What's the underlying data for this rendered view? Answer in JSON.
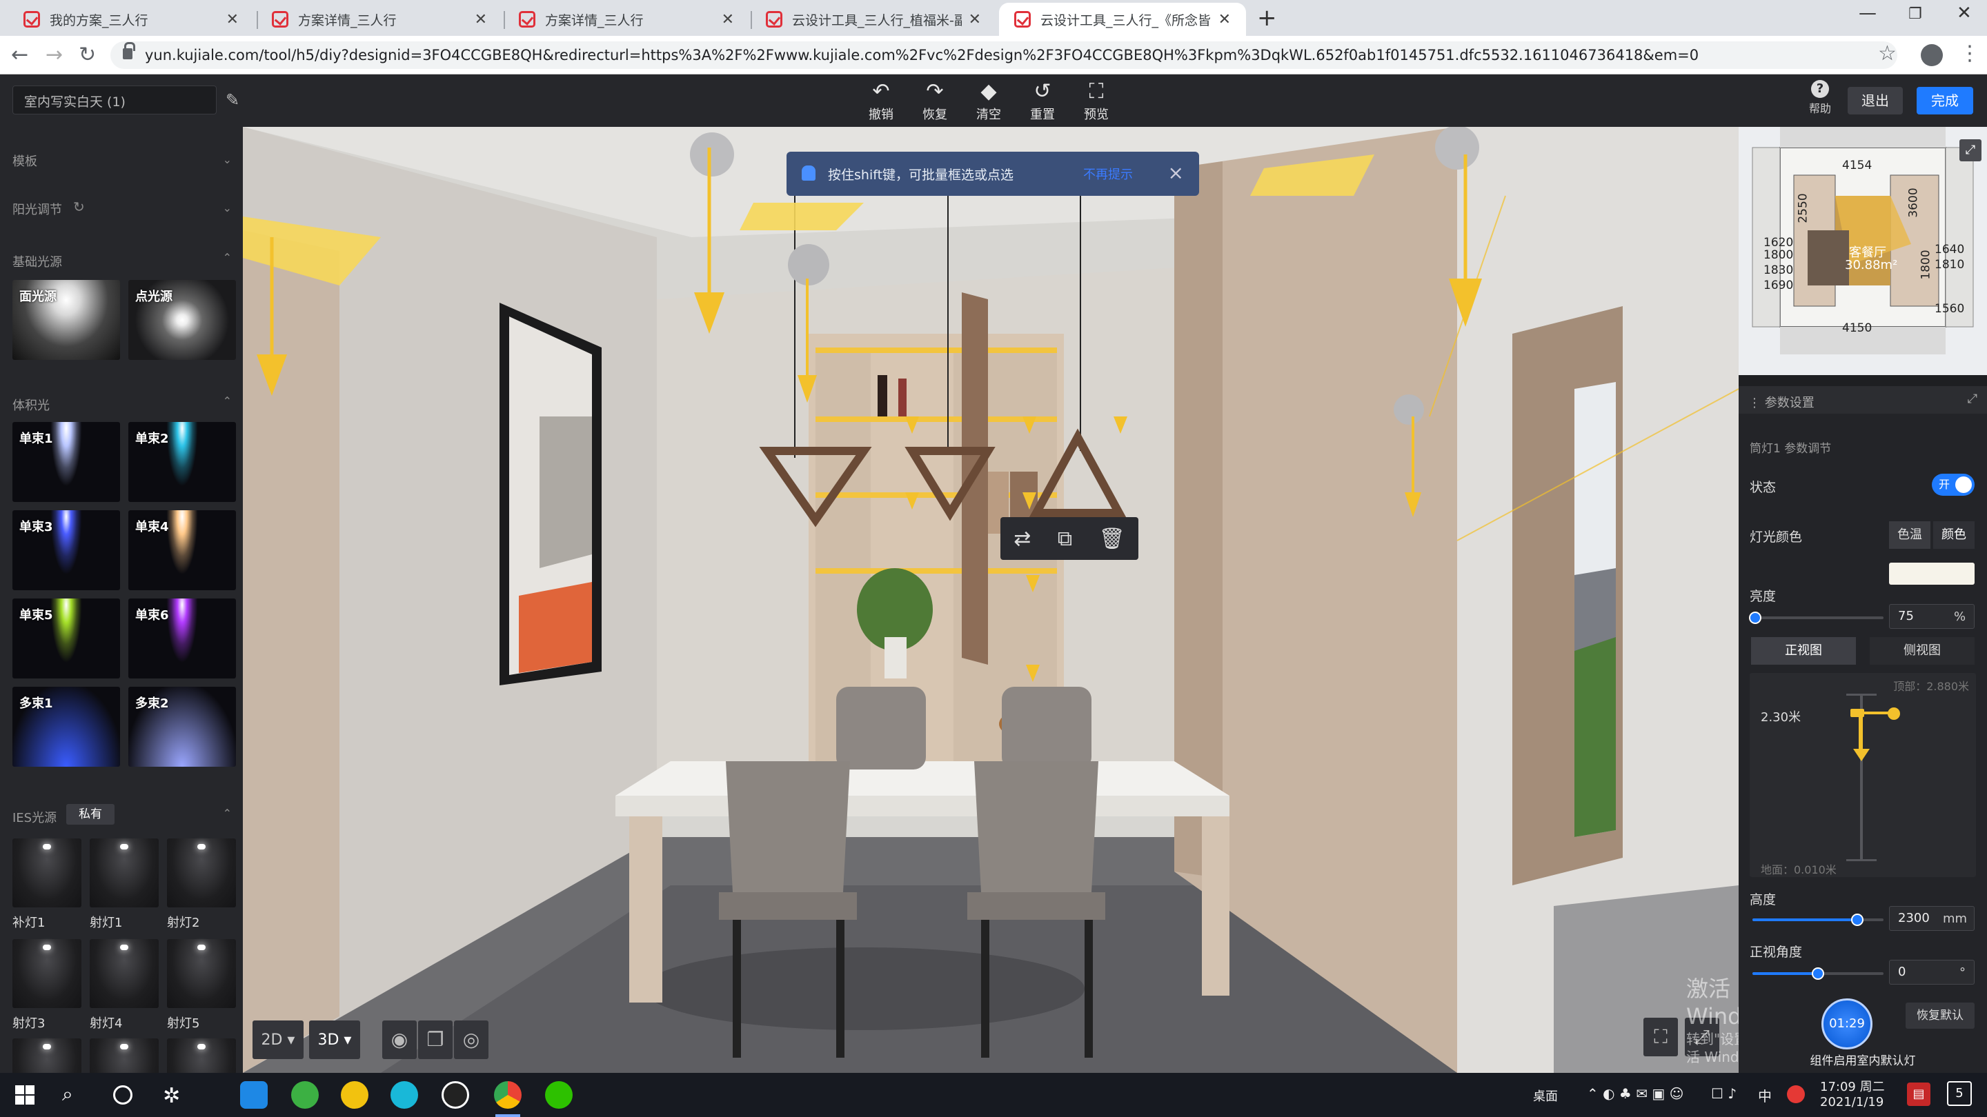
{
  "browser": {
    "tabs": [
      {
        "label": "我的方案_三人行",
        "active": false
      },
      {
        "label": "方案详情_三人行",
        "active": false
      },
      {
        "label": "方案详情_三人行",
        "active": false
      },
      {
        "label": "云设计工具_三人行_植福米-副本",
        "active": false
      },
      {
        "label": "云设计工具_三人行_《所念皆星",
        "active": true
      }
    ],
    "new_tab": "+",
    "url": "yun.kujiale.com/tool/h5/diy?designid=3FO4CCGBE8QH&redirecturl=https%3A%2F%2Fwww.kujiale.com%2Fvc%2Fdesign%2F3FO4CCGBE8QH%3Fkpm%3DqkWL.652f0ab1f0145751.dfc5532.1611046736418&em=0"
  },
  "app": {
    "scheme_name": "室内写实白天 (1)",
    "toolbar": [
      {
        "label": "撤销",
        "icon": "undo-icon",
        "glyph": "↶"
      },
      {
        "label": "恢复",
        "icon": "redo-icon",
        "glyph": "↷"
      },
      {
        "label": "清空",
        "icon": "eraser-icon",
        "glyph": "◆"
      },
      {
        "label": "重置",
        "icon": "reset-icon",
        "glyph": "↺"
      },
      {
        "label": "预览",
        "icon": "preview-icon",
        "glyph": "⛶"
      }
    ],
    "help": "帮助",
    "help_glyph": "?",
    "exit": "退出",
    "done": "完成"
  },
  "left": {
    "template": "模板",
    "sun": "阳光调节",
    "basic_lights": "基础光源",
    "basic": [
      {
        "label": "面光源"
      },
      {
        "label": "点光源"
      }
    ],
    "volume_lights": "体积光",
    "volume": [
      {
        "label": "单束1",
        "color": "#b9c6ff"
      },
      {
        "label": "单束2",
        "color": "#2ec4e8"
      },
      {
        "label": "单束3",
        "color": "#4a5cff"
      },
      {
        "label": "单束4",
        "color": "#ffc98a"
      },
      {
        "label": "单束5",
        "color": "#a6e02a"
      },
      {
        "label": "单束6",
        "color": "#b23cff"
      },
      {
        "label": "多束1",
        "color": "#3a5cff"
      },
      {
        "label": "多束2",
        "color": "#9aa6ff"
      }
    ],
    "ies": "IES光源",
    "ies_private": "私有",
    "ies_items": [
      "补灯1",
      "射灯1",
      "射灯2",
      "射灯3",
      "射灯4",
      "射灯5"
    ]
  },
  "viewport": {
    "tooltip": "按住shift键，可批量框选或点选",
    "tooltip_link": "不再提示",
    "view_2d": "2D",
    "view_3d": "3D",
    "watermark_title": "激活 Windows",
    "watermark_sub": "转到\"设置\"以激活 Windows。"
  },
  "minimap": {
    "dims": [
      "4154",
      "2550",
      "1800",
      "1620",
      "1830",
      "1690",
      "3600",
      "1640",
      "1810",
      "1560",
      "4150",
      "1800"
    ],
    "room_label": "客餐厅",
    "room_area": "30.88m²"
  },
  "params": {
    "header": "参数设置",
    "subtitle": "筒灯1 参数调节",
    "state_label": "状态",
    "state_value": "开",
    "light_color_label": "灯光颜色",
    "color_temp_tab": "色温",
    "color_tab": "颜色",
    "swatch_color": "#f6f3ea",
    "brightness_label": "亮度",
    "brightness_value": "75",
    "brightness_unit": "%",
    "brightness_fraction": 0.02,
    "front_view": "正视图",
    "side_view": "侧视图",
    "ceiling_label": "顶部：2.880米",
    "floor_label": "地面：0.010米",
    "fixture_height_label": "2.30米",
    "height_label": "高度",
    "height_value": "2300",
    "height_unit": "mm",
    "height_fraction": 0.8,
    "angle_label": "正视角度",
    "angle_value": "0",
    "angle_unit": "°",
    "angle_fraction": 0.5,
    "restore_default": "恢复默认",
    "footnote": "组件启用室内默认灯"
  },
  "recorder": {
    "time": "01:29"
  },
  "taskbar": {
    "desktop": "桌面",
    "ime": "中",
    "time": "17:09 周二",
    "date": "2021/1/19",
    "notify_count": "5"
  }
}
